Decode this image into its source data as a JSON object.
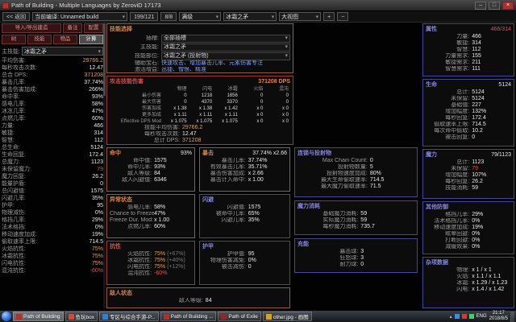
{
  "window": {
    "title": "Path of Building - Multiple Languages by ZeroviD 17173",
    "min": "–",
    "max": "□",
    "close": "×"
  },
  "menubar": {
    "back": "<< 返回",
    "build": "当前编译: Unnamed build",
    "points": "199/121",
    "asc": "8/8",
    "tree_select": "满级",
    "skill_select": "冰霜之矛",
    "view_select": "大视图",
    "zoom_in": "+",
    "zoom_out": "−"
  },
  "nav": {
    "import": "导入/导出建造",
    "notes": "备注",
    "config": "配置",
    "tree": "树",
    "skills": "技能",
    "items": "物品",
    "calcs": "计算"
  },
  "sidebar": {
    "main_skill_label": "主技能:",
    "main_skill": "冰霜之矛",
    "stats": [
      {
        "label": "平均伤害:",
        "value": "29766.2",
        "vc": "#e0a050"
      },
      {
        "label": "每秒攻击次数:",
        "value": "12.47",
        "vc": "#e8e8e8"
      },
      {
        "label": "总合 DPS:",
        "value": "371208",
        "vc": "#e0a050"
      },
      {
        "label": "暴击几率:",
        "value": "37.74%",
        "vc": "#e8e8e8"
      },
      {
        "label": "暴击伤害加成:",
        "value": "266%",
        "vc": "#e8e8e8"
      },
      {
        "label": "命中率:",
        "value": "93%",
        "vc": "#e8e8e8"
      },
      {
        "label": "感电几率:",
        "value": "58%",
        "vc": "#e8e8e8"
      },
      {
        "label": "冰冻几率:",
        "value": "47%",
        "vc": "#e8e8e8"
      },
      {
        "label": "点燃几率:",
        "value": "60%",
        "vc": "#e8e8e8"
      },
      {
        "label": "力量:",
        "value": "466",
        "vc": "#e8e8e8"
      },
      {
        "label": "敏捷:",
        "value": "314",
        "vc": "#e8e8e8"
      },
      {
        "label": "智慧:",
        "value": "112",
        "vc": "#e8e8e8"
      },
      {
        "label": "总生命:",
        "value": "5124",
        "vc": "#e8e8e8"
      },
      {
        "label": "生命回复:",
        "value": "172.4",
        "vc": "#e8e8e8"
      },
      {
        "label": "总魔力:",
        "value": "1123",
        "vc": "#e8e8e8"
      },
      {
        "label": "未保留魔力:",
        "value": "79",
        "vc": "#e05252"
      },
      {
        "label": "魔力回复:",
        "value": "26.2",
        "vc": "#e8e8e8"
      },
      {
        "label": "能量护盾:",
        "value": "0",
        "vc": "#e8e8e8"
      },
      {
        "label": "总闪避值:",
        "value": "1575",
        "vc": "#e8e8e8"
      },
      {
        "label": "闪避几率:",
        "value": "35%",
        "vc": "#e8e8e8"
      },
      {
        "label": "护甲:",
        "value": "95",
        "vc": "#e8e8e8"
      },
      {
        "label": "物理减伤:",
        "value": "0%",
        "vc": "#e8e8e8"
      },
      {
        "label": "格挡几率:",
        "value": "29%",
        "vc": "#e8e8e8"
      },
      {
        "label": "法术格挡:",
        "value": "0%",
        "vc": "#e8e8e8"
      },
      {
        "label": "移动速度加成:",
        "value": "19%",
        "vc": "#e8e8e8"
      },
      {
        "label": "偷取速率上限:",
        "value": "714.5",
        "vc": "#e8e8e8"
      },
      {
        "label": "火焰抗性:",
        "value": "75%",
        "vc": "#e0a050"
      },
      {
        "label": "冰霜抗性:",
        "value": "75%",
        "vc": "#e0a050"
      },
      {
        "label": "闪电抗性:",
        "value": "75%",
        "vc": "#e0a050"
      },
      {
        "label": "混沌抗性:",
        "value": "-60%",
        "vc": "#e05252"
      }
    ]
  },
  "panels": {
    "skill": {
      "title": "技能选择",
      "rows": [
        {
          "label": "插槽:",
          "value": "全部插槽"
        },
        {
          "label": "主技能:",
          "value": "冰霜之矛"
        },
        {
          "label": "技能部位:",
          "value": "冰霜之矛 (投射物)"
        }
      ],
      "supports_label": "辅助宝石:",
      "supports": "快速攻击、增加暴击几率、元素伤害专注",
      "buffs_label": "激活增益:",
      "buffs": "迅捷、憎恨、精准"
    },
    "damage": {
      "title": "攻击技能伤害",
      "dps": "371208 DPS",
      "headers": [
        "",
        "物理",
        "闪电",
        "冰霜",
        "火焰",
        "混沌"
      ],
      "rows": [
        {
          "label": "最小伤害",
          "c": [
            "0",
            "1218",
            "1856",
            "0",
            "0"
          ]
        },
        {
          "label": "最大伤害",
          "c": [
            "0",
            "4370",
            "3370",
            "0",
            "0"
          ]
        },
        {
          "label": "伤害加成",
          "c": [
            "x 1.38",
            "x 1.38",
            "x 1.42",
            "x 0",
            "x 0"
          ]
        },
        {
          "label": "更多加成",
          "c": [
            "x 1.11",
            "x 1.11",
            "x 1.11",
            "x 0",
            "x 0"
          ]
        },
        {
          "label": "Effective DPS Mod",
          "c": [
            "x 1.075",
            "x 1.075",
            "x 1.075",
            "x 0",
            "x 0"
          ]
        }
      ],
      "footer": [
        {
          "label": "技能平均伤害:",
          "value": "29766.2",
          "vc": "#e0a050"
        },
        {
          "label": "每秒攻击次数:",
          "value": "12.47",
          "vc": "#e8e8e8"
        },
        {
          "label": "总计 DPS:",
          "value": "371208",
          "vc": "#e0a050"
        }
      ]
    },
    "accuracy": {
      "title": "命中",
      "title_value": "93%",
      "rows": [
        {
          "label": "命中值:",
          "value": "1575"
        },
        {
          "label": "命中几率:",
          "value": "93%"
        },
        {
          "label": "敌人等级:",
          "value": "84"
        },
        {
          "label": "敌人闪避值:",
          "value": "6346"
        }
      ]
    },
    "crit": {
      "title": "暴击",
      "title_value": "37.74% x2.66",
      "rows": [
        {
          "label": "暴击几率:",
          "value": "37.74%"
        },
        {
          "label": "有效暴击几率:",
          "value": "35.71%"
        },
        {
          "label": "暴击伤害加成:",
          "value": "x 2.66"
        },
        {
          "label": "暴击计入命中:",
          "value": "x 1.00"
        }
      ]
    },
    "chains": {
      "title": "连锁与投射物",
      "rows": [
        {
          "label": "Max Chain Count:",
          "value": "0"
        },
        {
          "label": "投射物数量:",
          "value": "5"
        },
        {
          "label": "投射物速度加成:",
          "value": "80%"
        },
        {
          "label": "最大生命偷取速率:",
          "value": "714.5"
        },
        {
          "label": "最大魔力偷取速率:",
          "value": "71.5"
        }
      ]
    },
    "ailments": {
      "title": "异常状态",
      "rows": [
        {
          "label": "感电几率:",
          "value": "58%"
        },
        {
          "label": "Chance to Freeze:",
          "value": "47%"
        },
        {
          "label": "Freeze Dur. Mod:",
          "value": "x 1.00"
        },
        {
          "label": "点燃几率:",
          "value": "60%"
        }
      ]
    },
    "evasion": {
      "title": "闪避",
      "rows": [
        {
          "label": "闪避值:",
          "value": "1575"
        },
        {
          "label": "被命中几率:",
          "value": "65%"
        },
        {
          "label": "闪避几率:",
          "value": "35%"
        }
      ]
    },
    "manacost": {
      "title": "魔力消耗",
      "rows": [
        {
          "label": "基础魔力消耗:",
          "value": "59"
        },
        {
          "label": "实际魔力消耗:",
          "value": "59"
        },
        {
          "label": "每秒魔力消耗:",
          "value": "735.7"
        }
      ]
    },
    "resists": {
      "title": "抗性",
      "rows": [
        {
          "label": "火焰抗性:",
          "value": "75%",
          "extra": "(+67%)",
          "vc": "#e0a050"
        },
        {
          "label": "冰霜抗性:",
          "value": "75%",
          "extra": "(+40%)",
          "vc": "#e0a050"
        },
        {
          "label": "闪电抗性:",
          "value": "75%",
          "extra": "(+12%)",
          "vc": "#e0a050"
        },
        {
          "label": "混沌抗性:",
          "value": "-60%",
          "extra": "",
          "vc": "#e05252"
        }
      ]
    },
    "armour": {
      "title": "护甲",
      "rows": [
        {
          "label": "护甲值:",
          "value": "95"
        },
        {
          "label": "物理伤害减免:",
          "value": "0%"
        },
        {
          "label": "被击减伤:",
          "value": "0"
        }
      ]
    },
    "charges": {
      "title": "充能",
      "rows": [
        {
          "label": "暴击球:",
          "value": "3"
        },
        {
          "label": "狂怒球:",
          "value": "3"
        },
        {
          "label": "耐力球:",
          "value": "0"
        }
      ]
    },
    "enemy": {
      "title": "敌人状态",
      "rows": [
        {
          "label": "敌人等级:",
          "value": "84"
        }
      ]
    }
  },
  "right": {
    "attributes": {
      "title": "属性",
      "title_value": "466/314",
      "rows": [
        {
          "label": "力量:",
          "value": "466"
        },
        {
          "label": "敏捷:",
          "value": "314"
        },
        {
          "label": "智慧:",
          "value": "112"
        },
        {
          "label": "力量需求:",
          "value": "155"
        },
        {
          "label": "敏捷需求:",
          "value": "211"
        },
        {
          "label": "智慧需求:",
          "value": "111"
        }
      ]
    },
    "life": {
      "title": "生命",
      "title_value": "5124",
      "rows": [
        {
          "label": "总计:",
          "value": "5124"
        },
        {
          "label": "未保留:",
          "value": "5124"
        },
        {
          "label": "基础值:",
          "value": "227"
        },
        {
          "label": "增加幅度:",
          "value": "132%"
        },
        {
          "label": "每秒回复:",
          "value": "172.4"
        },
        {
          "label": "偷取速率上限:",
          "value": "714.5"
        },
        {
          "label": "每次命中偷取:",
          "value": "10.2"
        },
        {
          "label": "被击回复:",
          "value": "0"
        }
      ]
    },
    "mana": {
      "title": "魔力",
      "title_value": "79/1123",
      "rows": [
        {
          "label": "总计:",
          "value": "1123"
        },
        {
          "label": "未保留:",
          "value": "79",
          "vc": "#e05252"
        },
        {
          "label": "增加幅度:",
          "value": "107%"
        },
        {
          "label": "每秒回复:",
          "value": "26.2"
        },
        {
          "label": "技能消耗:",
          "value": "59"
        }
      ]
    },
    "defence": {
      "title": "其他防御",
      "rows": [
        {
          "label": "格挡几率:",
          "value": "29%"
        },
        {
          "label": "法术格挡几率:",
          "value": "0%"
        },
        {
          "label": "移动速度加成:",
          "value": "19%"
        },
        {
          "label": "眩晕回避:",
          "value": "0%"
        },
        {
          "label": "打断回避:",
          "value": "0%"
        },
        {
          "label": "减缓效果:",
          "value": "0%"
        }
      ]
    },
    "misc": {
      "title": "杂项数据",
      "rows": [
        {
          "label": "物理:",
          "value": "x 1 / x 1"
        },
        {
          "label": "火焰:",
          "value": "x 1.1 / x 1.1"
        },
        {
          "label": "冰霜:",
          "value": "x 1.29 / x 1.23"
        },
        {
          "label": "闪电:",
          "value": "x 1.4 / x 1.42"
        }
      ]
    }
  },
  "taskbar": {
    "items": [
      {
        "label": "Path of Building",
        "color": "#b03030",
        "active": "1"
      },
      {
        "label": "鱼玩box",
        "color": "#d44a2a",
        "active": ""
      },
      {
        "label": "专区与综合手游-P...",
        "color": "#2f7fd4",
        "active": ""
      },
      {
        "label": "Path of Building ...",
        "color": "#b03030",
        "active": ""
      },
      {
        "label": "Path of Exile",
        "color": "#8c2a2a",
        "active": ""
      },
      {
        "label": "other.jpg - 画图",
        "color": "#d4a12a",
        "active": ""
      }
    ],
    "lang": "ENG",
    "time": "21:17",
    "date": "2018/8/5"
  }
}
